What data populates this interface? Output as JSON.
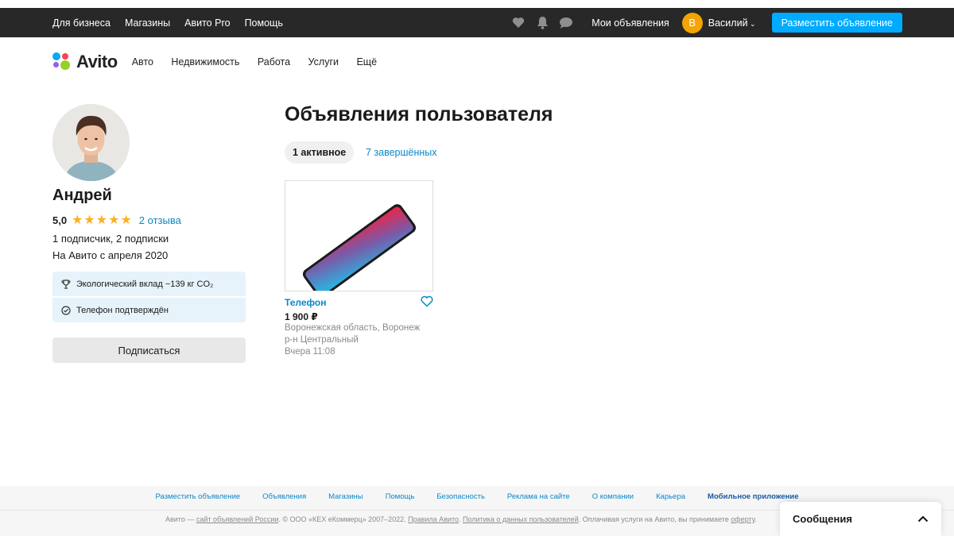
{
  "topbar": {
    "links": [
      "Для бизнеса",
      "Магазины",
      "Авито Pro",
      "Помощь"
    ],
    "my_ads": "Мои объявления",
    "avatar_letter": "В",
    "user_name": "Василий",
    "post_button": "Разместить объявление"
  },
  "header": {
    "logo": "Avito",
    "nav": [
      "Авто",
      "Недвижимость",
      "Работа",
      "Услуги",
      "Ещё"
    ]
  },
  "profile": {
    "name": "Андрей",
    "rating": "5,0",
    "stars": 5,
    "reviews": "2 отзыва",
    "subscribers": "1 подписчик, 2 подписки",
    "since": "На Авито с апреля 2020",
    "eco": "Экологический вклад −139 кг CO₂",
    "phone": "Телефон подтверждён",
    "subscribe_button": "Подписаться"
  },
  "main": {
    "title": "Объявления пользователя",
    "tab_active": "1 активное",
    "tab_done": "7 завершённых",
    "listing": {
      "title": "Телефон",
      "price": "1 900 ₽",
      "location_line1": "Воронежская область, Воронеж",
      "location_line2": "р-н Центральный",
      "date": "Вчера 11:08"
    }
  },
  "footer": {
    "links": [
      "Разместить объявление",
      "Объявления",
      "Магазины",
      "Помощь",
      "Безопасность",
      "Реклама на сайте",
      "О компании",
      "Карьера",
      "Мобильное приложение"
    ],
    "copy_prefix": "Авито — ",
    "copy_link1": "сайт объявлений России",
    "copy_mid": ". © ООО «КЕХ еКоммерц» 2007–2022. ",
    "copy_link2": "Правила Авито",
    "copy_sep": ". ",
    "copy_link3": "Политика о данных пользователей",
    "copy_tail": ". Оплачивая услуги на Авито, вы принимаете ",
    "copy_link4": "оферту",
    "copy_end": "."
  },
  "messages": {
    "label": "Сообщения"
  },
  "colors": {
    "topbar": "#282828",
    "accent_blue": "#00aaff",
    "link_blue": "#0a88c9",
    "star": "#ffb021",
    "avatar_orange": "#f4a404"
  }
}
